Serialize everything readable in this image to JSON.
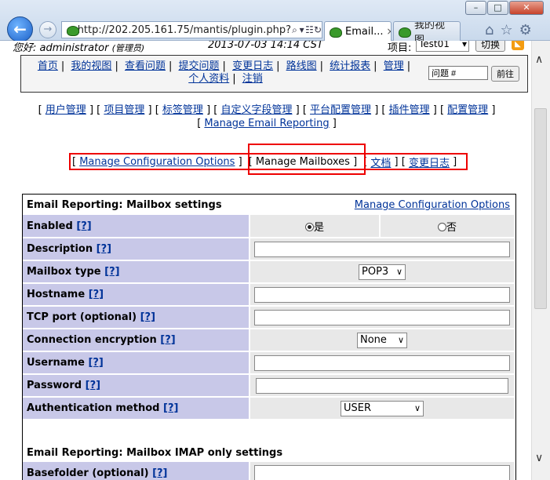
{
  "browser": {
    "window_controls": {
      "minimize": "–",
      "maximize": "□",
      "close": "✕"
    },
    "url": "http://202.205.161.75/mantis/plugin.php?",
    "tabs": [
      {
        "label": "Email...",
        "close": "×"
      },
      {
        "label": "我的视图..."
      }
    ]
  },
  "page": {
    "login": {
      "greeting": "您好: administrator",
      "role": "(管理员)",
      "datetime": "2013-07-03 14:14 CST",
      "project_label": "项目:",
      "project_value": "Test01",
      "switch_button": "切换"
    },
    "menu": {
      "items": [
        "首页",
        "我的视图",
        "查看问题",
        "提交问题",
        "变更日志",
        "路线图",
        "统计报表",
        "管理"
      ],
      "items_row2": [
        "个人资料",
        "注销"
      ],
      "jump_placeholder": "问题 #",
      "jump_button": "前往"
    },
    "admin_nav": {
      "row1": [
        "用户管理",
        "项目管理",
        "标签管理",
        "自定义字段管理",
        "平台配置管理",
        "插件管理",
        "配置管理"
      ],
      "row2": [
        "Manage Email Reporting"
      ]
    },
    "sub_nav": {
      "items": [
        "Manage Configuration Options",
        "Manage Mailboxes",
        "文档",
        "变更日志"
      ],
      "active": "Manage Mailboxes"
    },
    "mailbox_settings": {
      "title": "Email Reporting: Mailbox settings",
      "header_link": "Manage Configuration Options",
      "help": "[?]",
      "fields": {
        "enabled": {
          "label": "Enabled",
          "yes": "是",
          "no": "否",
          "selected": "是"
        },
        "description": {
          "label": "Description",
          "value": ""
        },
        "mailbox_type": {
          "label": "Mailbox type",
          "value": "POP3"
        },
        "hostname": {
          "label": "Hostname",
          "value": ""
        },
        "tcp_port": {
          "label": "TCP port (optional)",
          "value": ""
        },
        "encryption": {
          "label": "Connection encryption",
          "value": "None"
        },
        "username": {
          "label": "Username",
          "value": ""
        },
        "password": {
          "label": "Password",
          "value": ""
        },
        "auth_method": {
          "label": "Authentication method",
          "value": "USER"
        }
      }
    },
    "imap_settings": {
      "title": "Email Reporting: Mailbox IMAP only settings",
      "basefolder": {
        "label": "Basefolder (optional)",
        "value": ""
      }
    }
  }
}
